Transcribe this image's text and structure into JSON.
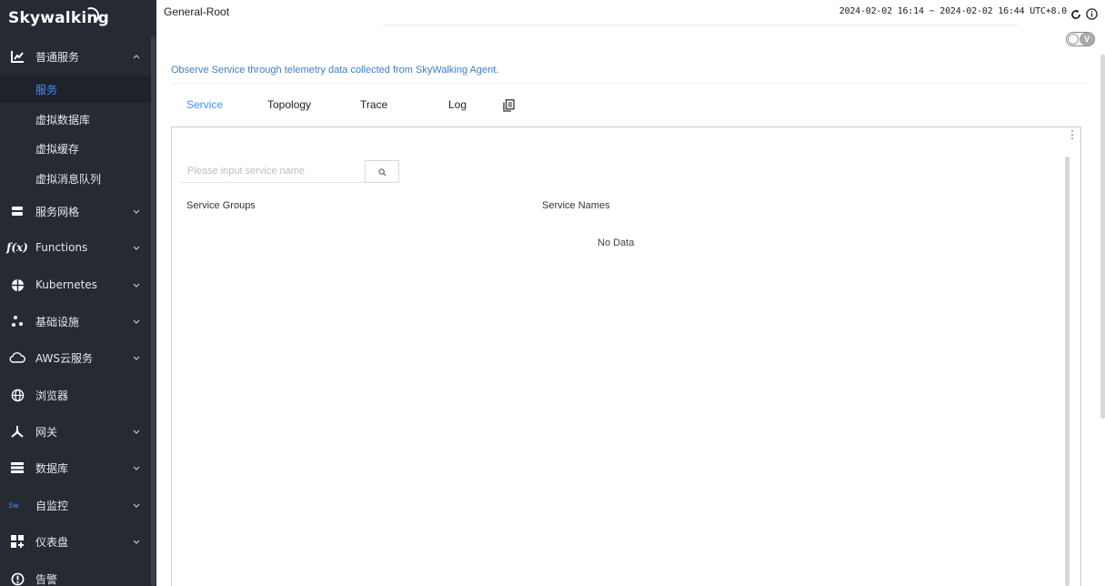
{
  "brand": {
    "logo_text": "Skywalking"
  },
  "sidebar": {
    "items": [
      {
        "label": "普通服务",
        "icon": "chart-icon",
        "expanded": true
      },
      {
        "label": "服务网格",
        "icon": "layers-icon"
      },
      {
        "label": "Functions",
        "icon": "function-icon"
      },
      {
        "label": "Kubernetes",
        "icon": "kubernetes-icon"
      },
      {
        "label": "基础设施",
        "icon": "infrastructure-icon"
      },
      {
        "label": "AWS云服务",
        "icon": "cloud-icon"
      },
      {
        "label": "浏览器",
        "icon": "globe-icon"
      },
      {
        "label": "网关",
        "icon": "gateway-icon"
      },
      {
        "label": "数据库",
        "icon": "database-icon"
      },
      {
        "label": "自监控",
        "icon": "self-monitor-icon"
      },
      {
        "label": "仪表盘",
        "icon": "dashboard-icon"
      },
      {
        "label": "告警",
        "icon": "alert-icon"
      }
    ],
    "subitems": [
      {
        "label": "服务",
        "active": true
      },
      {
        "label": "虚拟数据库"
      },
      {
        "label": "虚拟缓存"
      },
      {
        "label": "虚拟消息队列"
      }
    ]
  },
  "header": {
    "breadcrumb": "General-Root",
    "time_range": "2024-02-02 16:14 ~ 2024-02-02 16:44",
    "timezone": "UTC+8.0"
  },
  "toggle": {
    "label": "V"
  },
  "description": "Observe Service through telemetry data collected from SkyWalking Agent.",
  "tabs": [
    {
      "label": "Service",
      "active": true
    },
    {
      "label": "Topology"
    },
    {
      "label": "Trace"
    },
    {
      "label": "Log"
    }
  ],
  "panel": {
    "search_placeholder": "Please input service name",
    "column_groups": "Service Groups",
    "column_names": "Service Names",
    "empty_text": "No Data"
  },
  "colors": {
    "sidebar_bg": "#252a33",
    "accent": "#448dfe",
    "desc_text": "#3d7fbf"
  }
}
